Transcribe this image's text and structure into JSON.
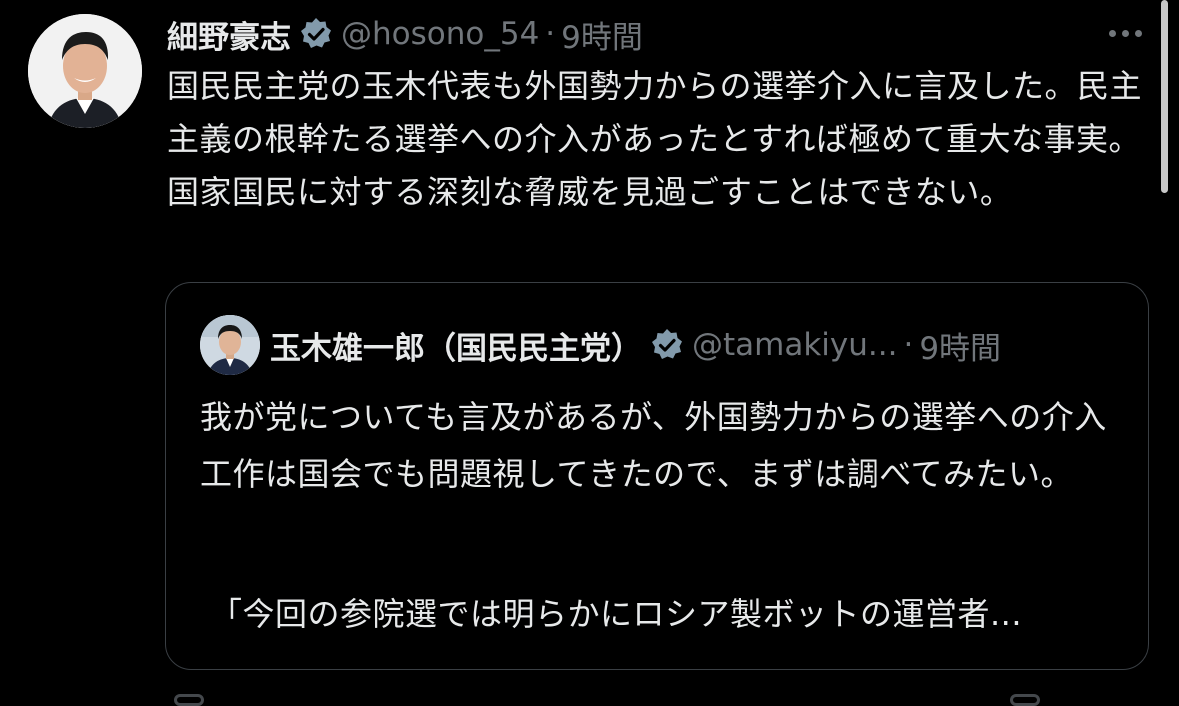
{
  "tweet": {
    "author_name": "細野豪志",
    "author_handle": "@hosono_54",
    "separator": "·",
    "time": "9時間",
    "text": "国民民主党の玉木代表も外国勢力からの選挙介入に言及した。民主主義の根幹たる選挙への介入があったとすれば極めて重大な事実。国家国民に対する深刻な脅威を見過ごすことはできない。",
    "verified_color": "#829aab",
    "more_icon": "more-horizontal-icon"
  },
  "quoted_tweet": {
    "author_name": "玉木雄一郎（国民民主党）",
    "author_handle": "@tamakiyu...",
    "separator": "·",
    "time": "9時間",
    "text": "我が党についても言及があるが、外国勢力からの選挙への介入工作は国会でも問題視してきたので、まずは調べてみたい。",
    "excerpt": "「今回の参院選では明らかにロシア製ボットの運営者..."
  },
  "colors": {
    "background": "#000000",
    "text_primary": "#e7e9ea",
    "text_secondary": "#71767b",
    "border": "#3a3f44"
  }
}
